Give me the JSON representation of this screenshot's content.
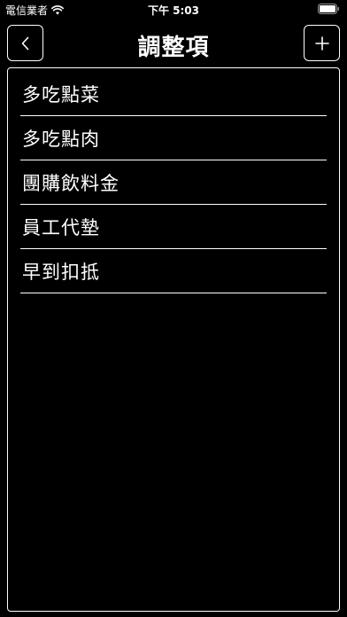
{
  "status_bar": {
    "carrier": "電信業者",
    "time": "下午 5:03"
  },
  "nav": {
    "title": "調整項",
    "back_icon": "chevron-left-icon",
    "add_icon": "plus-icon"
  },
  "items": [
    {
      "label": "多吃點菜"
    },
    {
      "label": "多吃點肉"
    },
    {
      "label": "團購飲料金"
    },
    {
      "label": "員工代墊"
    },
    {
      "label": "早到扣抵"
    }
  ],
  "colors": {
    "background": "#000000",
    "foreground": "#ffffff"
  }
}
